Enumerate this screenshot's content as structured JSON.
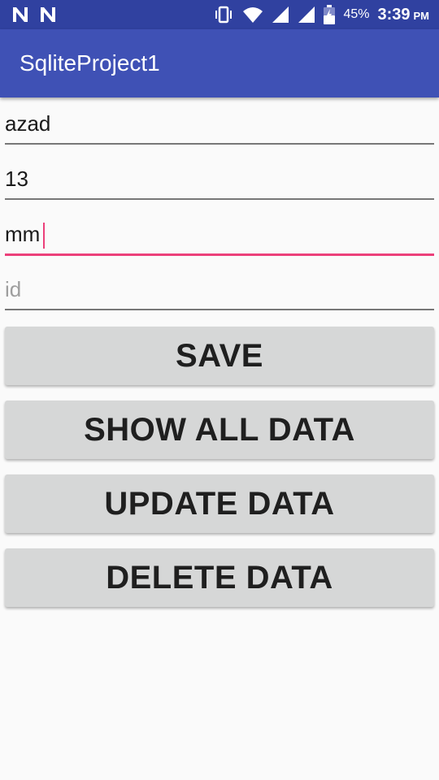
{
  "status_bar": {
    "battery_percent": "45%",
    "time": "3:39",
    "am_pm": "PM",
    "icons": [
      "notification-n-icon",
      "notification-n-icon",
      "vibrate-icon",
      "wifi-icon",
      "signal-icon",
      "signal-icon",
      "battery-icon"
    ]
  },
  "app_bar": {
    "title": "SqliteProject1",
    "color": "#3f51b5"
  },
  "form": {
    "name_value": "azad",
    "age_value": "13",
    "third_value": "mm",
    "id_placeholder": "id"
  },
  "buttons": {
    "save": "SAVE",
    "show_all": "SHOW ALL DATA",
    "update": "UPDATE DATA",
    "delete": "DELETE DATA"
  },
  "colors": {
    "accent": "#ec407a",
    "status_bar": "#3041a0",
    "button_bg": "#d6d7d7"
  }
}
